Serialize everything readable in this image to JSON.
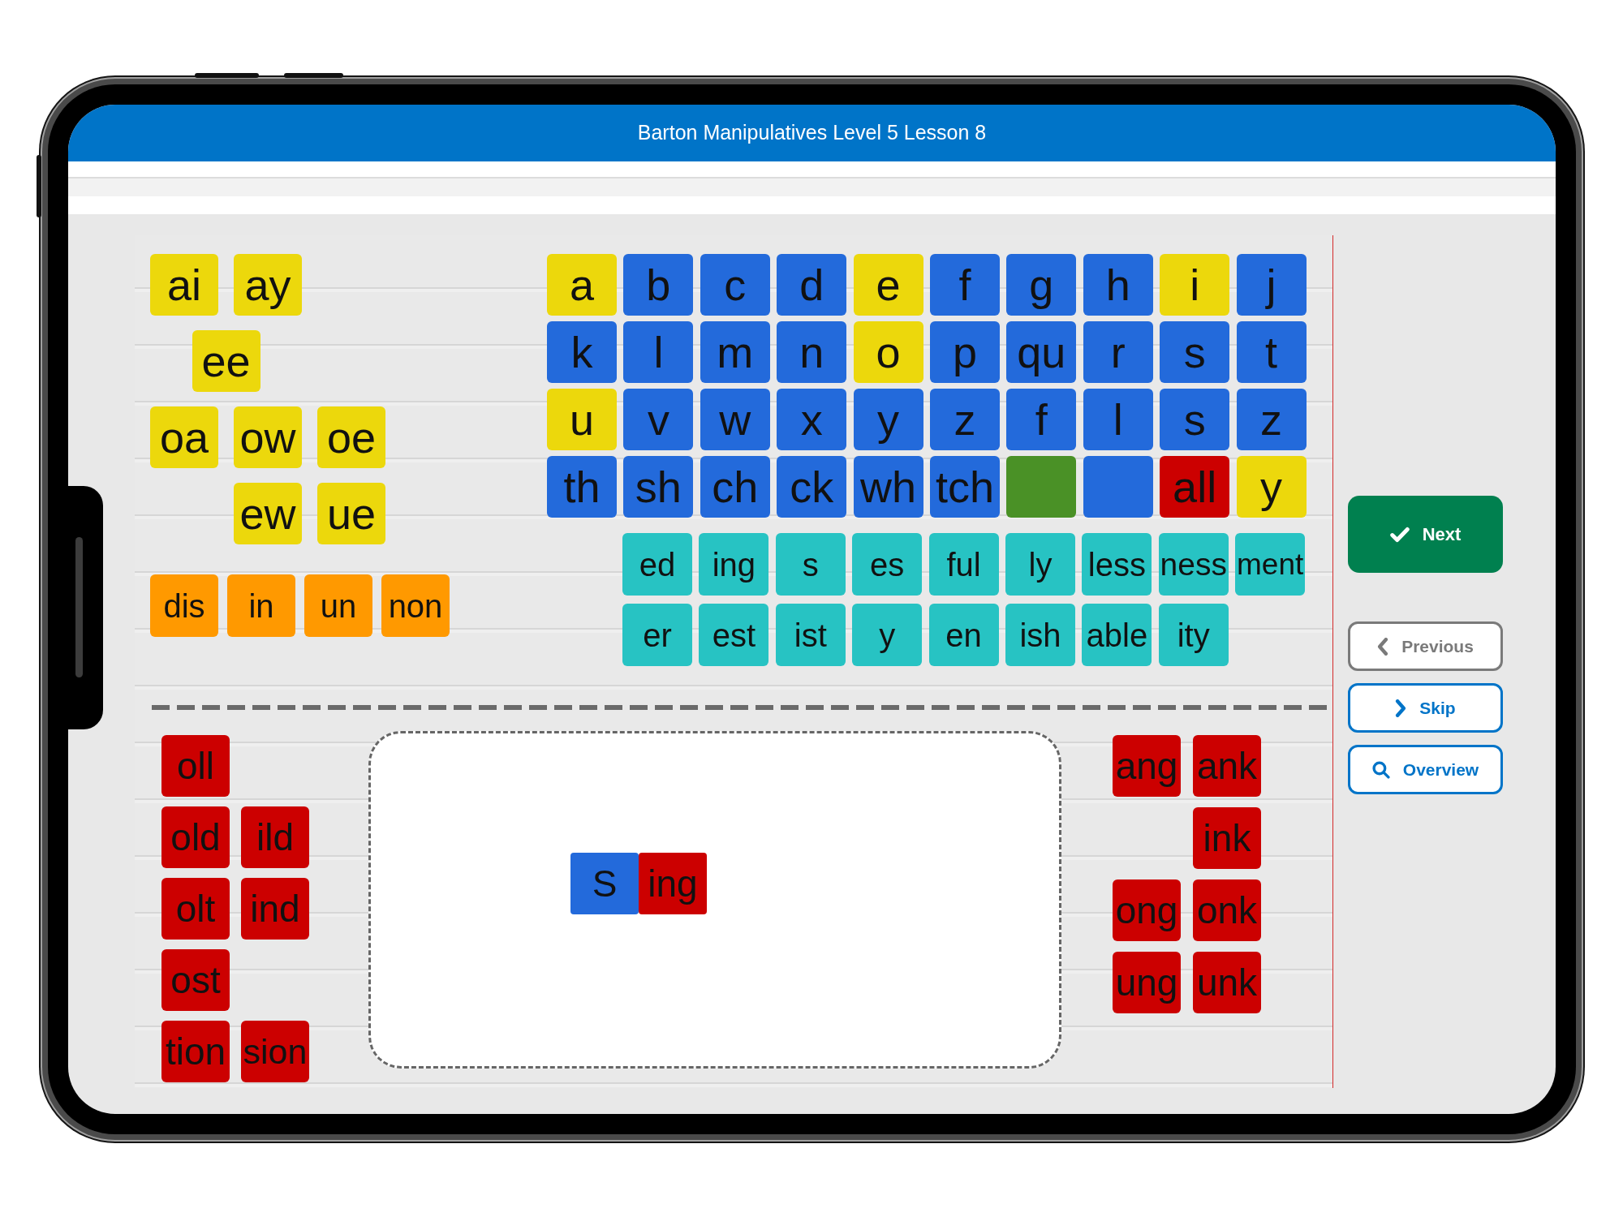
{
  "header": {
    "title": "Barton Manipulatives Level 5 Lesson 8"
  },
  "board": {
    "vowel_tiles": [
      [
        {
          "label": "ai",
          "color": "#ecd80c"
        },
        {
          "label": "ay",
          "color": "#ecd80c"
        }
      ],
      [
        {
          "label": "ee",
          "color": "#ecd80c"
        }
      ],
      [
        {
          "label": "oa",
          "color": "#ecd80c"
        },
        {
          "label": "ow",
          "color": "#ecd80c"
        },
        {
          "label": "oe",
          "color": "#ecd80c"
        }
      ],
      [
        {
          "label": "ew",
          "color": "#ecd80c"
        },
        {
          "label": "ue",
          "color": "#ecd80c"
        }
      ]
    ],
    "prefix_tiles": [
      {
        "label": "dis",
        "color": "#ff9900"
      },
      {
        "label": "in",
        "color": "#ff9900"
      },
      {
        "label": "un",
        "color": "#ff9900"
      },
      {
        "label": "non",
        "color": "#ff9900"
      }
    ],
    "letter_tiles": [
      [
        {
          "label": "a",
          "color": "#ecd80c"
        },
        {
          "label": "b",
          "color": "#236adb"
        },
        {
          "label": "c",
          "color": "#236adb"
        },
        {
          "label": "d",
          "color": "#236adb"
        },
        {
          "label": "e",
          "color": "#ecd80c"
        },
        {
          "label": "f",
          "color": "#236adb"
        },
        {
          "label": "g",
          "color": "#236adb"
        },
        {
          "label": "h",
          "color": "#236adb"
        },
        {
          "label": "i",
          "color": "#ecd80c"
        },
        {
          "label": "j",
          "color": "#236adb"
        }
      ],
      [
        {
          "label": "k",
          "color": "#236adb"
        },
        {
          "label": "l",
          "color": "#236adb"
        },
        {
          "label": "m",
          "color": "#236adb"
        },
        {
          "label": "n",
          "color": "#236adb"
        },
        {
          "label": "o",
          "color": "#ecd80c"
        },
        {
          "label": "p",
          "color": "#236adb"
        },
        {
          "label": "qu",
          "color": "#236adb"
        },
        {
          "label": "r",
          "color": "#236adb"
        },
        {
          "label": "s",
          "color": "#236adb"
        },
        {
          "label": "t",
          "color": "#236adb"
        }
      ],
      [
        {
          "label": "u",
          "color": "#ecd80c"
        },
        {
          "label": "v",
          "color": "#236adb"
        },
        {
          "label": "w",
          "color": "#236adb"
        },
        {
          "label": "x",
          "color": "#236adb"
        },
        {
          "label": "y",
          "color": "#236adb"
        },
        {
          "label": "z",
          "color": "#236adb"
        },
        {
          "label": "f",
          "color": "#236adb"
        },
        {
          "label": "l",
          "color": "#236adb"
        },
        {
          "label": "s",
          "color": "#236adb"
        },
        {
          "label": "z",
          "color": "#236adb"
        }
      ],
      [
        {
          "label": "th",
          "color": "#236adb"
        },
        {
          "label": "sh",
          "color": "#236adb"
        },
        {
          "label": "ch",
          "color": "#236adb"
        },
        {
          "label": "ck",
          "color": "#236adb"
        },
        {
          "label": "wh",
          "color": "#236adb"
        },
        {
          "label": "tch",
          "color": "#236adb"
        },
        {
          "color": "#4a9126"
        },
        {
          "color": "#236adb"
        },
        {
          "label": "all",
          "color": "#cc0000"
        },
        {
          "label": "y",
          "color": "#ecd80c"
        }
      ]
    ],
    "suffix_tiles": [
      [
        {
          "label": "ed",
          "color": "#27c3c3"
        },
        {
          "label": "ing",
          "color": "#27c3c3"
        },
        {
          "label": "s",
          "color": "#27c3c3"
        },
        {
          "label": "es",
          "color": "#27c3c3"
        },
        {
          "label": "ful",
          "color": "#27c3c3"
        },
        {
          "label": "ly",
          "color": "#27c3c3"
        },
        {
          "label": "less",
          "color": "#27c3c3"
        },
        {
          "label": "ness",
          "color": "#27c3c3"
        },
        {
          "label": "ment",
          "color": "#27c3c3"
        }
      ],
      [
        {
          "label": "er",
          "color": "#27c3c3"
        },
        {
          "label": "est",
          "color": "#27c3c3"
        },
        {
          "label": "ist",
          "color": "#27c3c3"
        },
        {
          "label": "y",
          "color": "#27c3c3"
        },
        {
          "label": "en",
          "color": "#27c3c3"
        },
        {
          "label": "ish",
          "color": "#27c3c3"
        },
        {
          "label": "able",
          "color": "#27c3c3"
        },
        {
          "label": "ity",
          "color": "#27c3c3"
        }
      ]
    ],
    "left_ending_tiles": [
      [
        {
          "label": "oll",
          "color": "#cc0000"
        }
      ],
      [
        {
          "label": "old",
          "color": "#cc0000"
        },
        {
          "label": "ild",
          "color": "#cc0000"
        }
      ],
      [
        {
          "label": "olt",
          "color": "#cc0000"
        },
        {
          "label": "ind",
          "color": "#cc0000"
        }
      ],
      [
        {
          "label": "ost",
          "color": "#cc0000"
        }
      ],
      [
        {
          "label": "tion",
          "color": "#cc0000"
        },
        {
          "label": "sion",
          "color": "#cc0000"
        }
      ]
    ],
    "work_area": {
      "tiles": [
        {
          "label": "S",
          "color": "#236adb"
        },
        {
          "label": "ing",
          "color": "#cc0000"
        }
      ]
    },
    "right_ending_tiles": [
      [
        {
          "label": "ang",
          "color": "#cc0000"
        },
        {
          "label": "ank",
          "color": "#cc0000"
        }
      ],
      [
        {
          "label": "ink",
          "color": "#cc0000"
        }
      ],
      [
        {
          "label": "ong",
          "color": "#cc0000"
        },
        {
          "label": "onk",
          "color": "#cc0000"
        }
      ],
      [
        {
          "label": "ung",
          "color": "#cc0000"
        },
        {
          "label": "unk",
          "color": "#cc0000"
        }
      ]
    ]
  },
  "next_button": {
    "label": "Next"
  },
  "nav_buttons": [
    {
      "label": "Previous",
      "kind": "previous",
      "disabled": true
    },
    {
      "label": "Skip",
      "kind": "skip",
      "disabled": false
    },
    {
      "label": "Overview",
      "kind": "overview",
      "disabled": false
    }
  ]
}
